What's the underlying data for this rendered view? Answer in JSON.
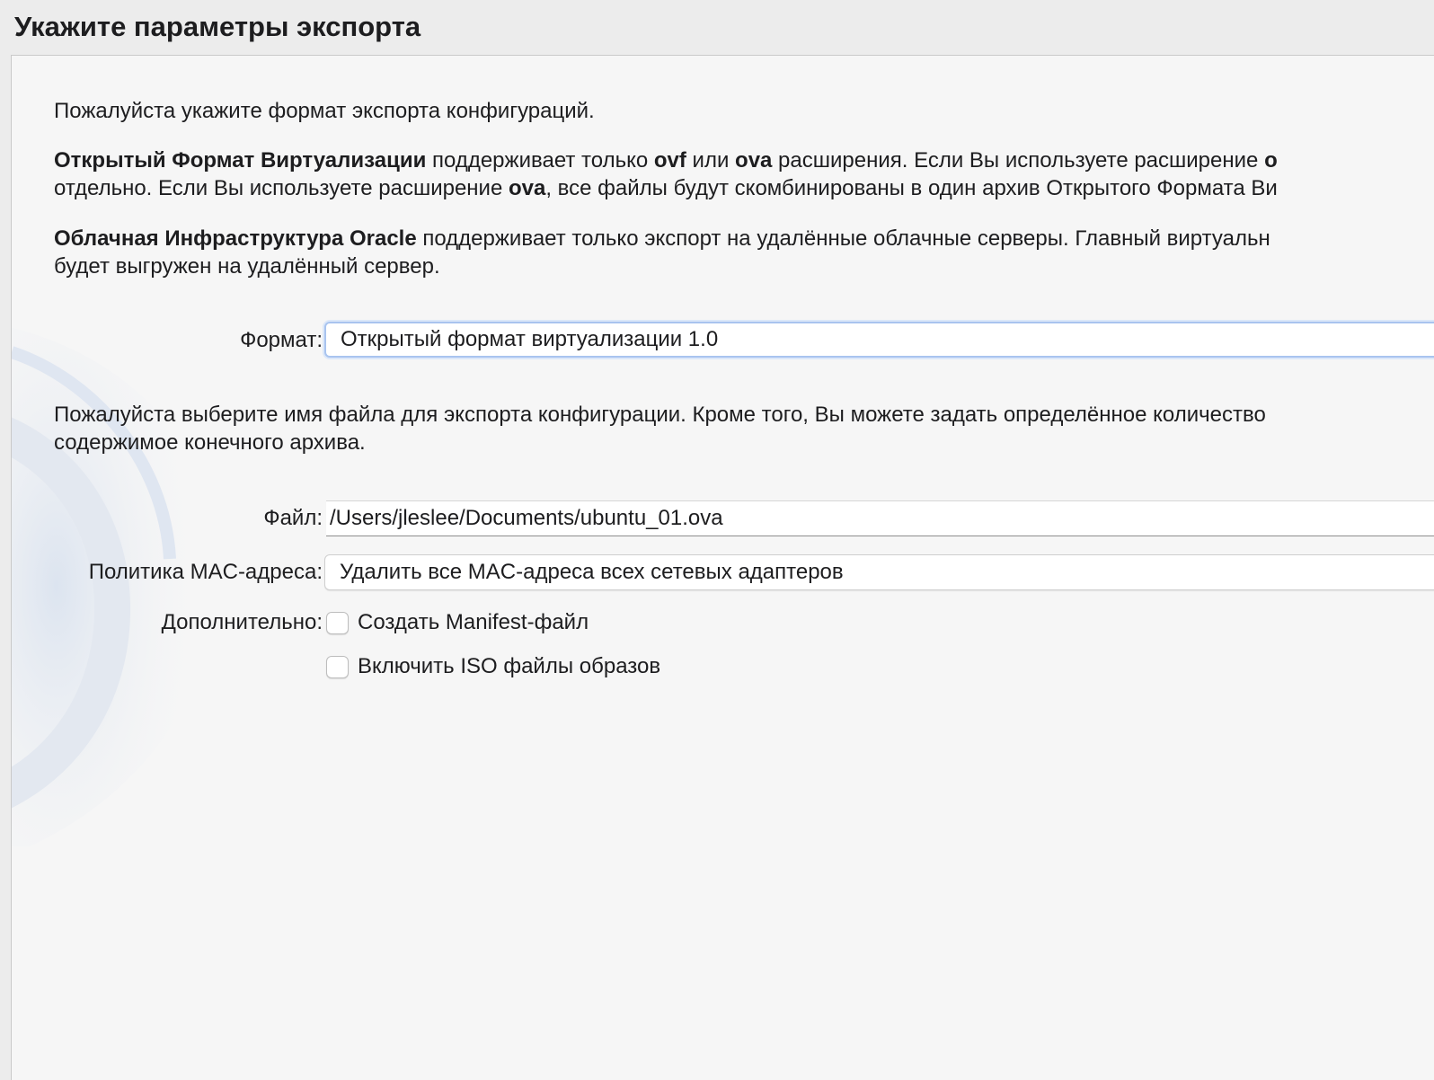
{
  "header": {
    "title": "Укажите параметры экспорта"
  },
  "intro": {
    "line1": "Пожалуйста укажите формат экспорта конфигураций."
  },
  "ovf_paragraph": {
    "bold1": "Открытый Формат Виртуализации",
    "t1": " поддерживает только ",
    "bold2": "ovf",
    "t2": " или ",
    "bold3": "ova",
    "t3": " расширения. Если Вы используете расширение ",
    "bold4": "o",
    "line2a": "отдельно. Если Вы используете расширение ",
    "bold5": "ova",
    "line2b": ", все файлы будут скомбинированы в один архив Открытого Формата Ви"
  },
  "oci_paragraph": {
    "bold1": "Облачная Инфраструктура Oracle",
    "t1": " поддерживает только экспорт на удалённые облачные серверы. Главный виртуальн",
    "line2": "будет выгружен на удалённый сервер."
  },
  "format": {
    "label": "Формат:",
    "value": "Открытый формат виртуализации 1.0"
  },
  "file_paragraph": {
    "line1": "Пожалуйста выберите имя файла для экспорта конфигурации. Кроме того, Вы можете задать определённое количество",
    "line2": "содержимое конечного архива."
  },
  "file": {
    "label": "Файл:",
    "value": "/Users/jleslee/Documents/ubuntu_01.ova"
  },
  "mac_policy": {
    "label": "Политика MAC-адреса:",
    "value": "Удалить все MAC-адреса всех сетевых адаптеров"
  },
  "additional": {
    "label": "Дополнительно:",
    "options": [
      {
        "label": "Создать Manifest-файл",
        "checked": false
      },
      {
        "label": "Включить ISO файлы образов",
        "checked": false
      }
    ]
  }
}
